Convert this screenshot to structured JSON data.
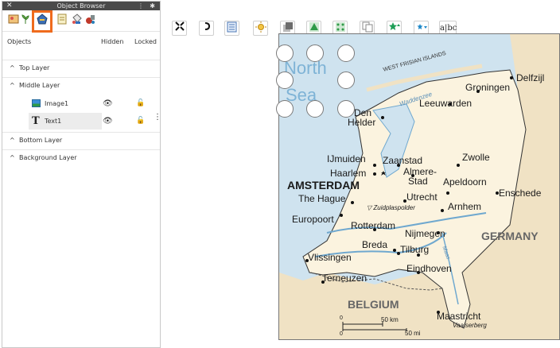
{
  "panel": {
    "title": "Object Browser",
    "close_glyph": "✕",
    "menu_glyph": "⋮",
    "pin_glyph": "✱",
    "tool_icons": [
      "image-frame-icon",
      "plant-icon",
      "shape-pen-icon",
      "page-icon",
      "paint-bucket-icon",
      "tools-icon"
    ],
    "columns": {
      "objects": "Objects",
      "hidden": "Hidden",
      "locked": "Locked"
    },
    "layers": [
      {
        "label": "Top Layer"
      },
      {
        "label": "Middle Layer"
      },
      {
        "label": "Bottom Layer"
      },
      {
        "label": "Background Layer"
      }
    ],
    "objects": [
      {
        "name": "Image1",
        "icon": "image-icon"
      },
      {
        "name": "Text1",
        "icon": "text-icon",
        "selected": true
      }
    ],
    "accent": "#ef6b1d"
  },
  "toolbar": {
    "items": [
      {
        "name": "fit-icon",
        "glyph": "⤧"
      },
      {
        "name": "rotate-icon",
        "glyph": "↻"
      },
      {
        "name": "document-icon",
        "glyph": "▤"
      },
      {
        "name": "sun-icon",
        "glyph": "✺"
      },
      {
        "name": "layers-icon",
        "glyph": "◧"
      },
      {
        "name": "green-arrow-icon",
        "glyph": "▲"
      },
      {
        "name": "green-dots-icon",
        "glyph": "⁘"
      },
      {
        "name": "duplicate-icon",
        "glyph": "❐"
      },
      {
        "name": "star-up-icon",
        "glyph": "★"
      },
      {
        "name": "star-down-icon",
        "glyph": "★"
      },
      {
        "name": "text-cursor-icon",
        "glyph": "abc"
      }
    ]
  },
  "map": {
    "labels": {
      "north_sea_1": "North",
      "north_sea_2": "Sea",
      "west_frisian": "WEST FRISIAN ISLANDS",
      "delfzijl": "Delfzijl",
      "groningen": "Groningen",
      "waddenzee": "Waddenzee",
      "leeuwarden": "Leeuwarden",
      "den": "Den",
      "helder": "Helder",
      "ijmuiden": "IJmuiden",
      "zaanstad": "Zaanstad",
      "zwolle": "Zwolle",
      "haarlem": "Haarlem",
      "almere1": "Almere-",
      "almere2": "Stad",
      "amsterdam": "AMSTERDAM",
      "apeldoorn": "Apeldoorn",
      "hague": "The Hague",
      "utrecht": "Utrecht",
      "enschede": "Enschede",
      "zuidplas": "▽ Zuidplaspolder",
      "arnhem": "Arnhem",
      "europoort": "Europoort",
      "rotterdam": "Rotterdam",
      "nijmegen": "Nijmegen",
      "germany": "GERMANY",
      "breda": "Breda",
      "tilburg": "Tilburg",
      "vlissingen": "Vlissingen",
      "eindhoven": "Eindhoven",
      "maas": "Maas",
      "terneuzen": "Terneuzen",
      "belgium": "BELGIUM",
      "maastricht": "Maastricht",
      "vaalserberg": "Vaalserberg",
      "scale_km": "50 km",
      "scale_mi": "50 mi",
      "scale_zero_km": "0",
      "scale_zero_mi": "0"
    },
    "colors": {
      "sea": "#cfe3ef",
      "land_nl": "#fbf3df",
      "land_other": "#f0e2c4",
      "border": "#333333",
      "water": "#6fa8cf"
    }
  }
}
